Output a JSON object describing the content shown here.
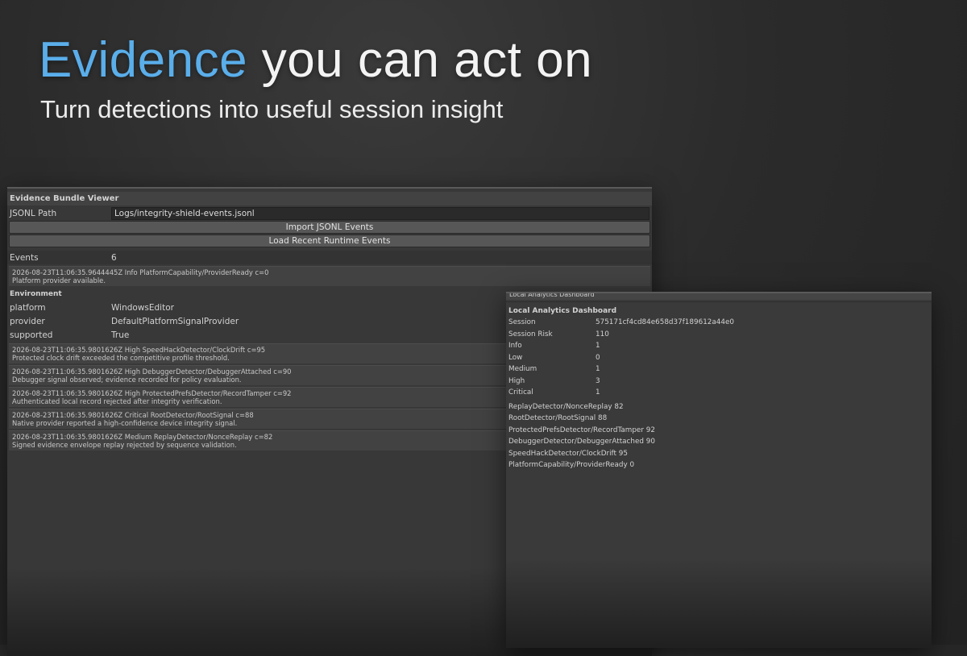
{
  "hero": {
    "accent": "Evidence",
    "rest": " you can act on",
    "subtitle": "Turn detections into useful session insight",
    "accent_color": "#5aaeea"
  },
  "viewer": {
    "title": "Evidence Bundle Viewer",
    "path_label": "JSONL Path",
    "path_value": "Logs/integrity-shield-events.jsonl",
    "import_button": "Import JSONL Events",
    "load_button": "Load Recent Runtime Events",
    "events_label": "Events",
    "events_count": "6",
    "first_entry": {
      "line1": "2026-08-23T11:06:35.9644445Z Info PlatformCapability/ProviderReady c=0",
      "line2": "Platform provider available."
    },
    "environment_title": "Environment",
    "environment": [
      {
        "key": "platform",
        "value": "WindowsEditor"
      },
      {
        "key": "provider",
        "value": "DefaultPlatformSignalProvider"
      },
      {
        "key": "supported",
        "value": "True"
      }
    ],
    "entries": [
      {
        "line1": "2026-08-23T11:06:35.9801626Z High SpeedHackDetector/ClockDrift c=95",
        "line2": "Protected clock drift exceeded the competitive profile threshold."
      },
      {
        "line1": "2026-08-23T11:06:35.9801626Z High DebuggerDetector/DebuggerAttached c=90",
        "line2": "Debugger signal observed; evidence recorded for policy evaluation."
      },
      {
        "line1": "2026-08-23T11:06:35.9801626Z High ProtectedPrefsDetector/RecordTamper c=92",
        "line2": "Authenticated local record rejected after integrity verification."
      },
      {
        "line1": "2026-08-23T11:06:35.9801626Z Critical RootDetector/RootSignal c=88",
        "line2": "Native provider reported a high-confidence device integrity signal."
      },
      {
        "line1": "2026-08-23T11:06:35.9801626Z Medium ReplayDetector/NonceReplay c=82",
        "line2": "Signed evidence envelope replay rejected by sequence validation."
      }
    ]
  },
  "dashboard": {
    "clipped_title": "Local Analytics Dashboard",
    "title": "Local Analytics Dashboard",
    "stats": [
      {
        "key": "Session",
        "value": "575171cf4cd84e658d37f189612a44e0"
      },
      {
        "key": "Session Risk",
        "value": "110"
      },
      {
        "key": "Info",
        "value": "1"
      },
      {
        "key": "Low",
        "value": "0"
      },
      {
        "key": "Medium",
        "value": "1"
      },
      {
        "key": "High",
        "value": "3"
      },
      {
        "key": "Critical",
        "value": "1"
      }
    ],
    "detectors": [
      "ReplayDetector/NonceReplay 82",
      "RootDetector/RootSignal 88",
      "ProtectedPrefsDetector/RecordTamper 92",
      "DebuggerDetector/DebuggerAttached 90",
      "SpeedHackDetector/ClockDrift 95",
      "PlatformCapability/ProviderReady 0"
    ]
  }
}
